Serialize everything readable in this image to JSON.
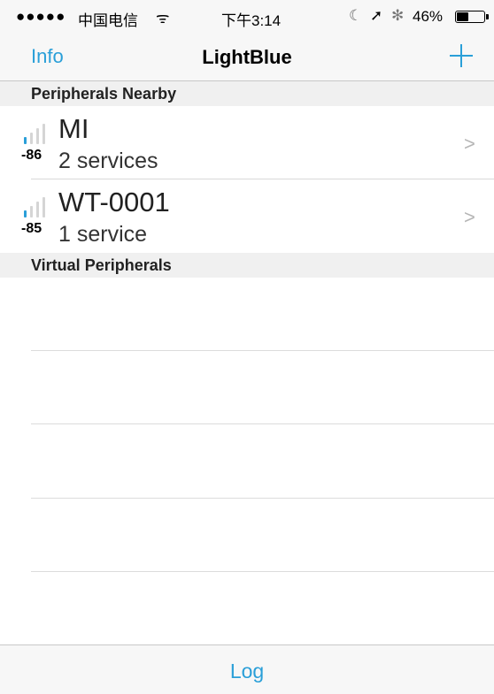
{
  "status_bar": {
    "signal_dots": "●●●●●",
    "carrier": "中国电信",
    "wifi_glyph": "ᯤ",
    "time": "下午3:14",
    "moon_glyph": "☾",
    "location_glyph": "➚",
    "bluetooth_glyph": "✻",
    "battery_text": "46%",
    "battery_level": 0.46
  },
  "nav": {
    "left_label": "Info",
    "title": "LightBlue",
    "right_icon": "plus-icon"
  },
  "sections": {
    "nearby_title": "Peripherals Nearby",
    "virtual_title": "Virtual Peripherals"
  },
  "peripherals": [
    {
      "name": "MI",
      "rssi": "-86",
      "services": "2 services",
      "chevron": ">"
    },
    {
      "name": "WT-0001",
      "rssi": "-85",
      "services": "1 service",
      "chevron": ">"
    }
  ],
  "tab_bar": {
    "log_label": "Log"
  },
  "colors": {
    "accent": "#2a9fd8",
    "signal_active": "#2a9fd8",
    "signal_inactive": "#d5d5d5"
  }
}
